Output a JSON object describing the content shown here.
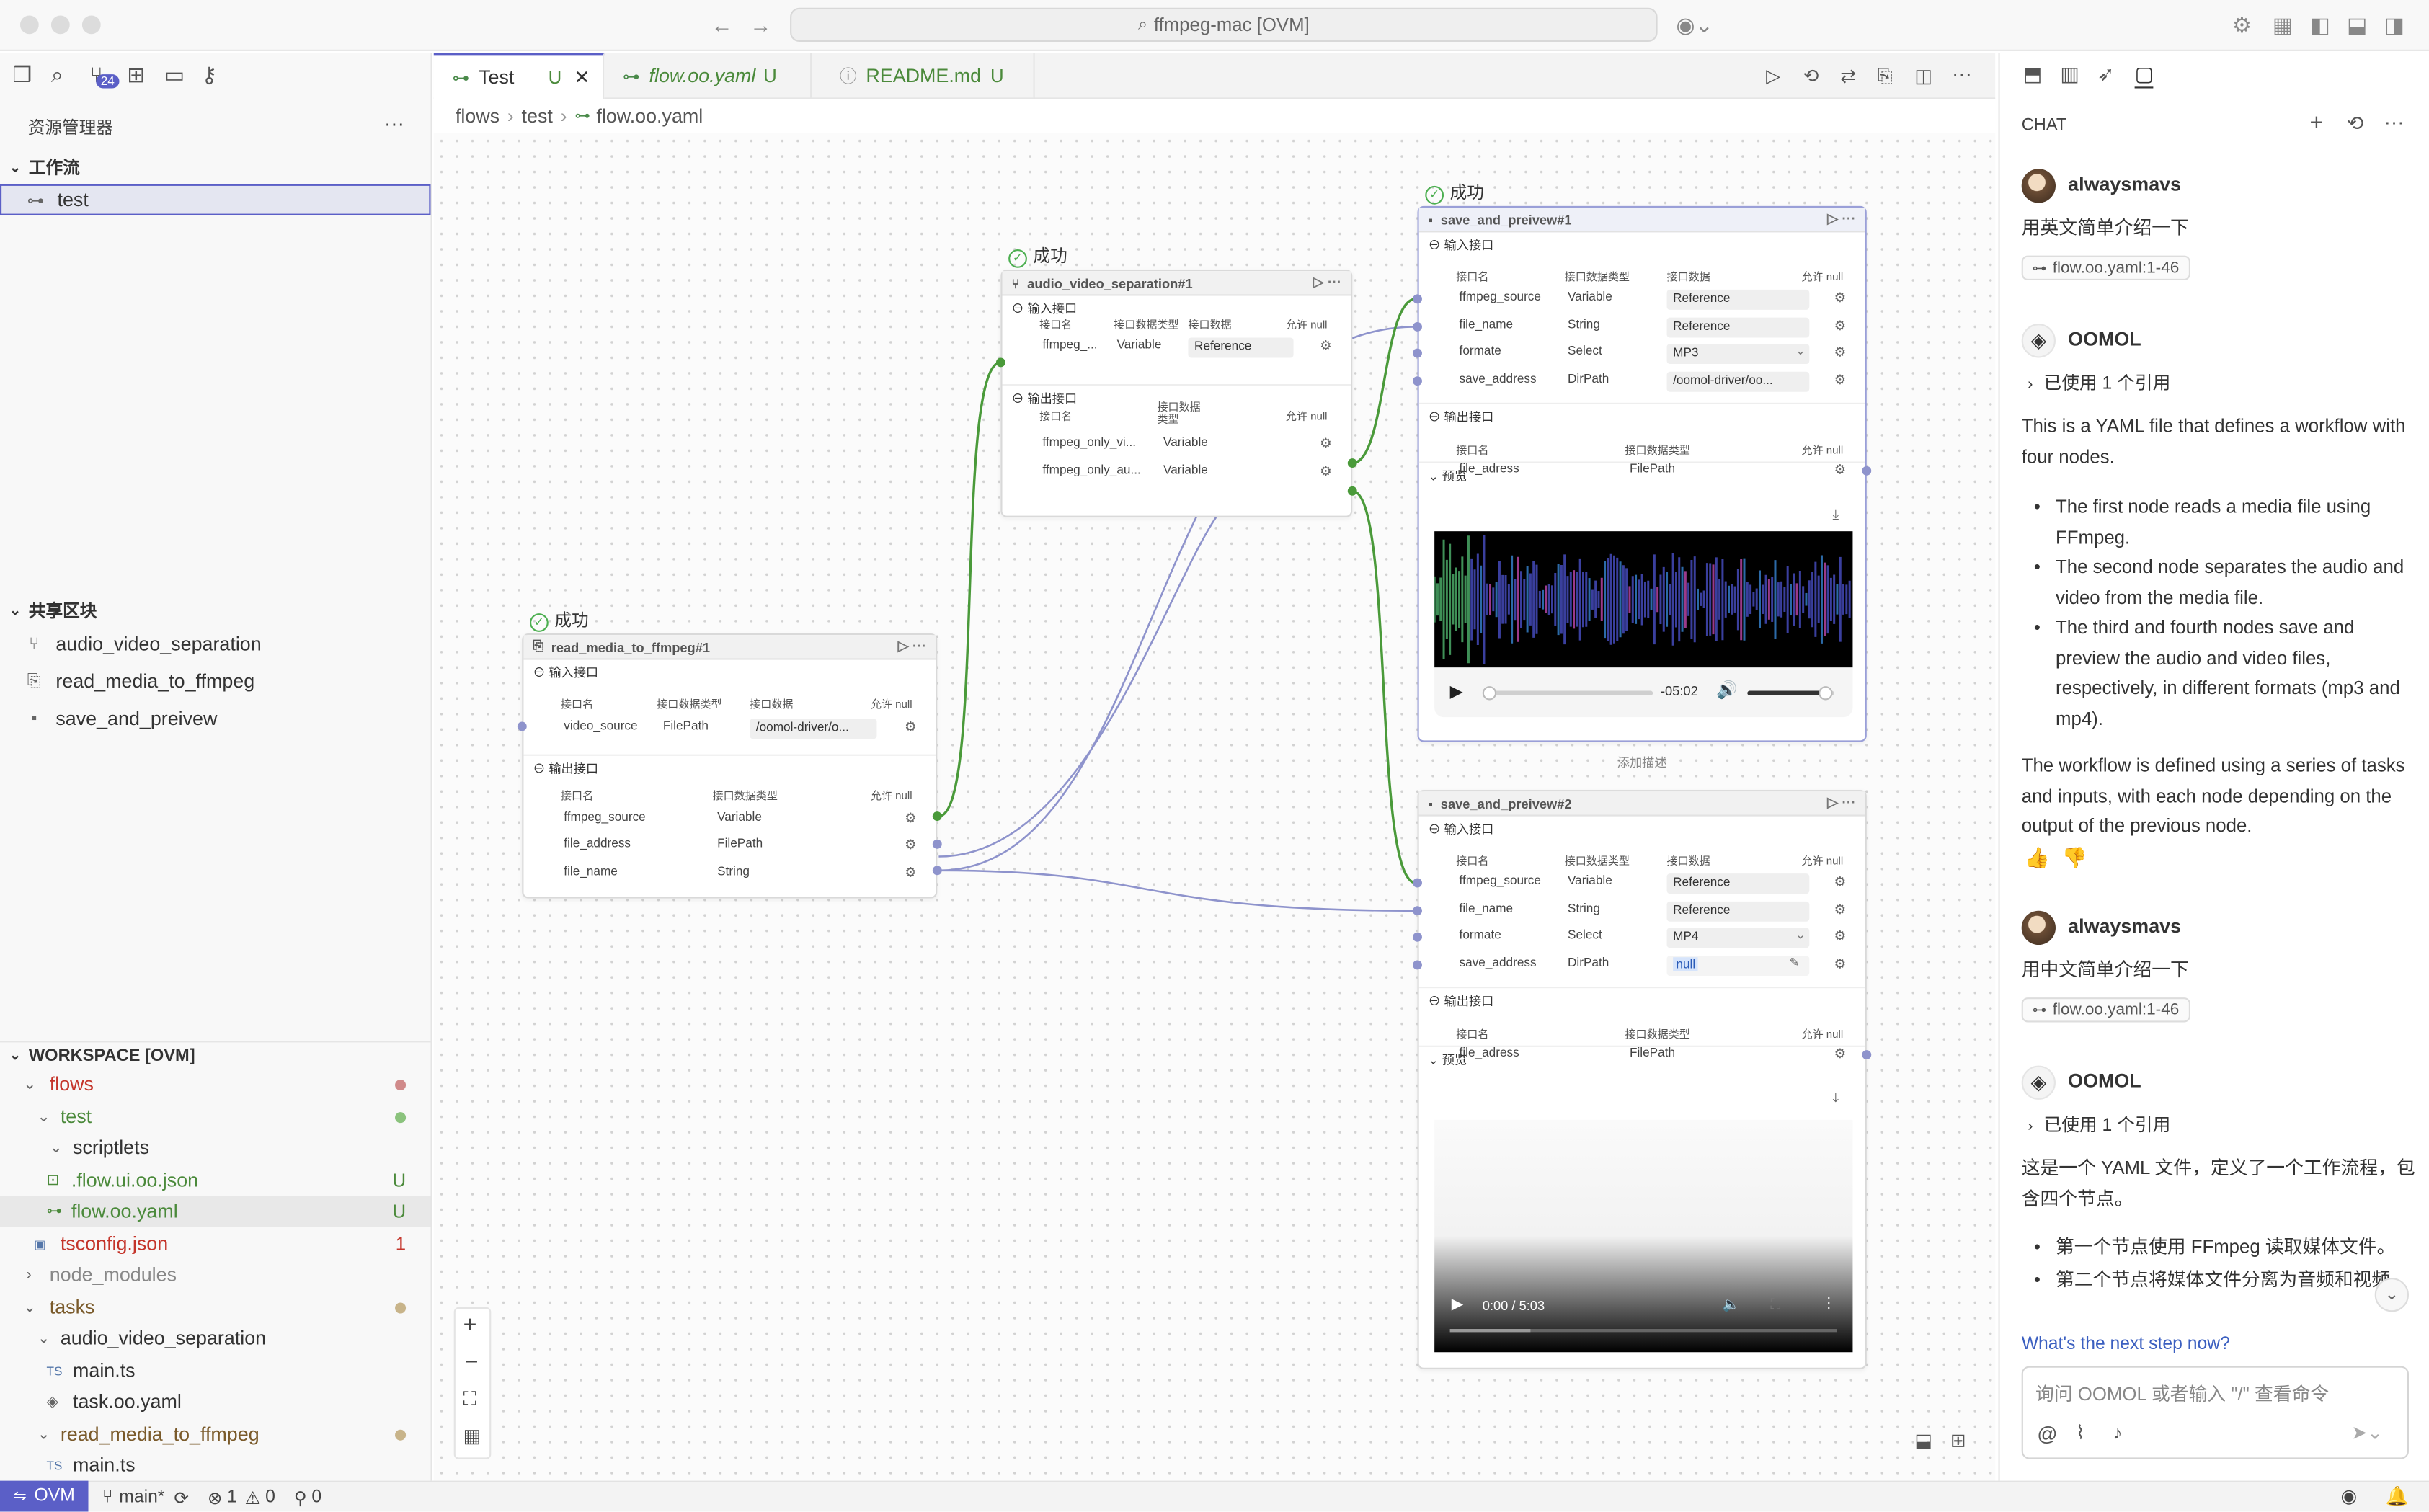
{
  "window": {
    "title": "ffmpeg-mac [OVM]"
  },
  "activity_bar": {
    "source_control_badge": "24"
  },
  "sidebar": {
    "title": "资源管理器",
    "workflow_section": "工作流",
    "workflow_item": "test",
    "shared_section": "共享区块",
    "shared_items": [
      "audio_video_separation",
      "read_media_to_ffmpeg",
      "save_and_preivew"
    ],
    "workspace_section": "WORKSPACE [OVM]",
    "tree": [
      {
        "label": "flows",
        "badge": ""
      },
      {
        "label": "test",
        "badge": ""
      },
      {
        "label": "scriptlets",
        "badge": ""
      },
      {
        "label": ".flow.ui.oo.json",
        "badge": "U"
      },
      {
        "label": "flow.oo.yaml",
        "badge": "U"
      },
      {
        "label": "tsconfig.json",
        "badge": "1"
      },
      {
        "label": "node_modules",
        "badge": ""
      },
      {
        "label": "tasks",
        "badge": ""
      },
      {
        "label": "audio_video_separation",
        "badge": ""
      },
      {
        "label": "main.ts",
        "badge": ""
      },
      {
        "label": "task.oo.yaml",
        "badge": ""
      },
      {
        "label": "read_media_to_ffmpeg",
        "badge": ""
      },
      {
        "label": "main.ts",
        "badge": ""
      }
    ],
    "icon_labels": {
      "ts": "TS"
    }
  },
  "tabs": [
    {
      "label": "Test",
      "badge": "U"
    },
    {
      "label": "flow.oo.yaml",
      "badge": "U"
    },
    {
      "label": "README.md",
      "badge": "U"
    }
  ],
  "breadcrumb": [
    "flows",
    "test",
    "flow.oo.yaml"
  ],
  "canvas": {
    "success_label": "成功",
    "input_label": "输入接口",
    "output_label": "输出接口",
    "preview_label": "预览",
    "add_desc": "添加描述",
    "col_name": "接口名",
    "col_type": "接口数据类型",
    "col_data": "接口数据",
    "col_null": "允许 null",
    "node1": {
      "title": "read_media_to_ffmpeg#1",
      "inputs": [
        {
          "name": "video_source",
          "type": "FilePath",
          "value": "/oomol-driver/o..."
        }
      ],
      "outputs": [
        {
          "name": "ffmpeg_source",
          "type": "Variable"
        },
        {
          "name": "file_address",
          "type": "FilePath"
        },
        {
          "name": "file_name",
          "type": "String"
        }
      ]
    },
    "node2": {
      "title": "audio_video_separation#1",
      "inputs": [
        {
          "name": "ffmpeg_...",
          "type": "Variable",
          "value": "Reference"
        }
      ],
      "outputs": [
        {
          "name": "ffmpeg_only_vi...",
          "type": "Variable"
        },
        {
          "name": "ffmpeg_only_au...",
          "type": "Variable"
        }
      ]
    },
    "node3": {
      "title": "save_and_preivew#1",
      "inputs": [
        {
          "name": "ffmpeg_source",
          "type": "Variable",
          "value": "Reference"
        },
        {
          "name": "file_name",
          "type": "String",
          "value": "Reference"
        },
        {
          "name": "formate",
          "type": "Select",
          "value": "MP3"
        },
        {
          "name": "save_address",
          "type": "DirPath",
          "value": "/oomol-driver/oo..."
        }
      ],
      "outputs": [
        {
          "name": "file_adress",
          "type": "FilePath"
        }
      ],
      "audio_time": "-05:02",
      "audio_progress": 0.02,
      "audio_volume": 0.9
    },
    "node4": {
      "title": "save_and_preivew#2",
      "inputs": [
        {
          "name": "ffmpeg_source",
          "type": "Variable",
          "value": "Reference"
        },
        {
          "name": "file_name",
          "type": "String",
          "value": "Reference"
        },
        {
          "name": "formate",
          "type": "Select",
          "value": "MP4"
        },
        {
          "name": "save_address",
          "type": "DirPath",
          "value": "null"
        }
      ],
      "outputs": [
        {
          "name": "file_adress",
          "type": "FilePath"
        }
      ],
      "video_time": "0:00 / 5:03",
      "video_progress": 0.0
    }
  },
  "chat": {
    "title": "CHAT",
    "messages": [
      {
        "user": "alwaysmavs",
        "text": "用英文简单介绍一下",
        "ref": "flow.oo.yaml:1-46"
      },
      {
        "user": "OOMOL",
        "used": "已使用 1 个引用",
        "p1": "This is a YAML file that defines a workflow with four nodes.",
        "bullets": [
          "The first node reads a media file using FFmpeg.",
          "The second node separates the audio and video from the media file.",
          "The third and fourth nodes save and preview the audio and video files, respectively, in different formats (mp3 and mp4)."
        ],
        "p2": "The workflow is defined using a series of tasks and inputs, with each node depending on the output of the previous node."
      },
      {
        "user": "alwaysmavs",
        "text": "用中文简单介绍一下",
        "ref": "flow.oo.yaml:1-46"
      },
      {
        "user": "OOMOL",
        "used": "已使用 1 个引用",
        "p1": "这是一个 YAML 文件，定义了一个工作流程，包含四个节点。",
        "bullets": [
          "第一个节点使用 FFmpeg 读取媒体文件。",
          "第二个节点将媒体文件分离为音频和视频。"
        ]
      }
    ],
    "suggestion": "What's the next step now?",
    "input_placeholder": "询问 OOMOL 或者输入 \"/\" 查看命令"
  },
  "statusbar": {
    "remote": "OVM",
    "branch": "main*",
    "errors": "1",
    "warnings": "0",
    "ports": "0"
  },
  "colors": {
    "accent": "#5b5fc7",
    "success": "#4caf50",
    "untracked": "#4b8a3b",
    "error": "#c4342a",
    "edge_green": "#4a9a3a",
    "edge_purple": "#8e93cc"
  }
}
